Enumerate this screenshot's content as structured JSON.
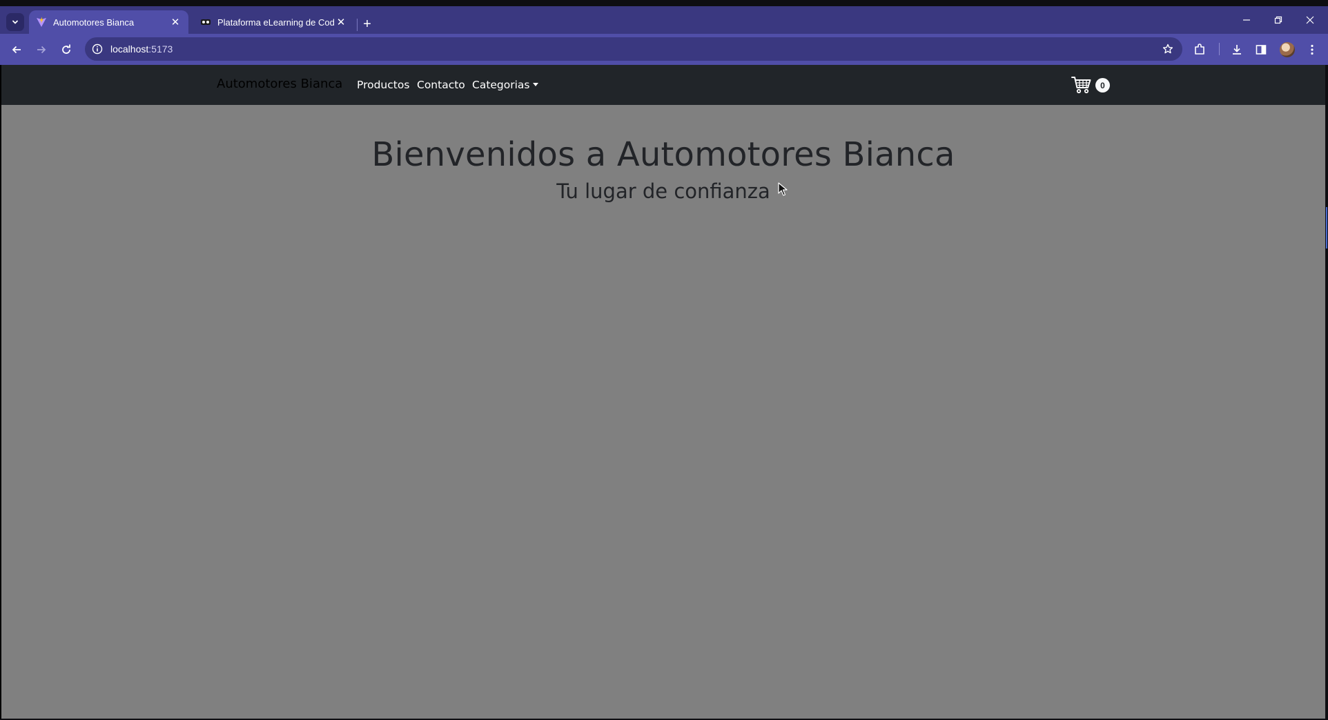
{
  "browser": {
    "tabs": [
      {
        "title": "Automotores Bianca",
        "active": true,
        "favicon": "vite-logo-icon"
      },
      {
        "title": "Plataforma eLearning de Coder",
        "active": false,
        "favicon": "coderhouse-logo-icon"
      }
    ],
    "address": {
      "host": "localhost",
      "port": ":5173"
    },
    "colors": {
      "tabbar": "#3a3880",
      "toolbar": "#504ea8",
      "omnibox": "#3a3880"
    }
  },
  "page": {
    "navbar": {
      "brand": "Automotores Bianca",
      "links": [
        "Productos",
        "Contacto",
        "Categorias"
      ],
      "cart_count": "0"
    },
    "hero": {
      "title": "Bienvenidos a Automotores Bianca",
      "subtitle": "Tu lugar de confianza"
    },
    "colors": {
      "navbar_bg": "#212529",
      "page_bg": "#808080",
      "heading": "#222428"
    }
  }
}
